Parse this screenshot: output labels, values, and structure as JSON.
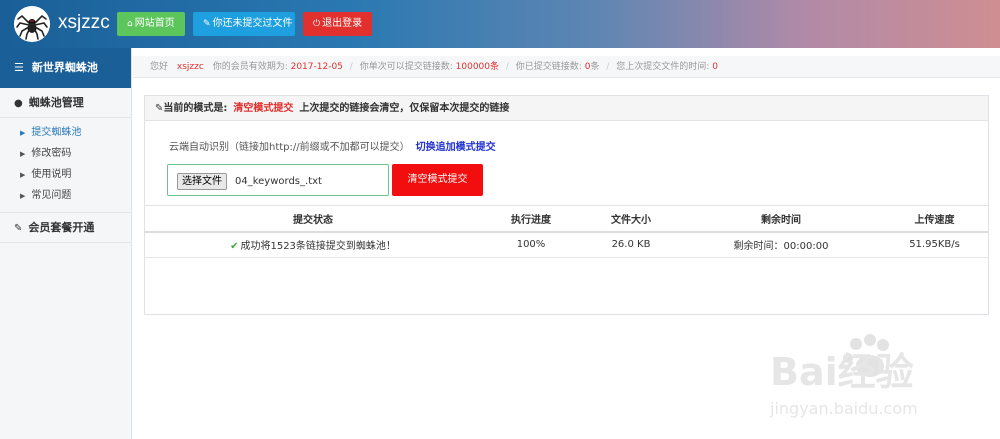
{
  "header": {
    "brand": "xsjzzc",
    "buttons": [
      {
        "label": "网站首页",
        "icon": "home-icon"
      },
      {
        "label": "你还未提交过文件",
        "icon": "wrench-icon"
      },
      {
        "label": "退出登录",
        "icon": "power-icon"
      }
    ]
  },
  "sidebar": {
    "title": "新世界蜘蛛池",
    "section1": "蜘蛛池管理",
    "items": [
      {
        "label": "提交蜘蛛池"
      },
      {
        "label": "修改密码"
      },
      {
        "label": "使用说明"
      },
      {
        "label": "常见问题"
      }
    ],
    "section2": "会员套餐开通"
  },
  "infobar": {
    "hello": "您好",
    "user": "xsjzzc",
    "expire_label": "你的会员有效期为:",
    "expire_value": "2017-12-05",
    "limit_label": "你单次可以提交链接数:",
    "limit_value": "100000条",
    "submitted_label": "你已提交链接数:",
    "submitted_value": "0",
    "submitted_unit": "条",
    "last_label": "您上次提交文件的时间:",
    "last_value": "0"
  },
  "panel": {
    "mode_label": "当前的模式是:",
    "mode_value": "清空模式提交",
    "mode_desc": "上次提交的链接会清空，仅保留本次提交的链接",
    "desc": "云端自动识别（链接加http://前缀或不加都可以提交）",
    "switch_link": "切换追加模式提交",
    "file_button": "选择文件",
    "file_name": "04_keywords_.txt",
    "submit_button": "清空模式提交"
  },
  "table": {
    "headers": [
      "提交状态",
      "执行进度",
      "文件大小",
      "剩余时间",
      "上传速度"
    ],
    "row": {
      "status": "成功将1523条链接提交到蜘蛛池！",
      "progress": "100%",
      "size": "26.0 KB",
      "remaining": "剩余时间：00:00:00",
      "speed": "51.95KB/s"
    }
  },
  "watermark": {
    "brand": "Bai经验",
    "url": "jingyan.baidu.com"
  }
}
